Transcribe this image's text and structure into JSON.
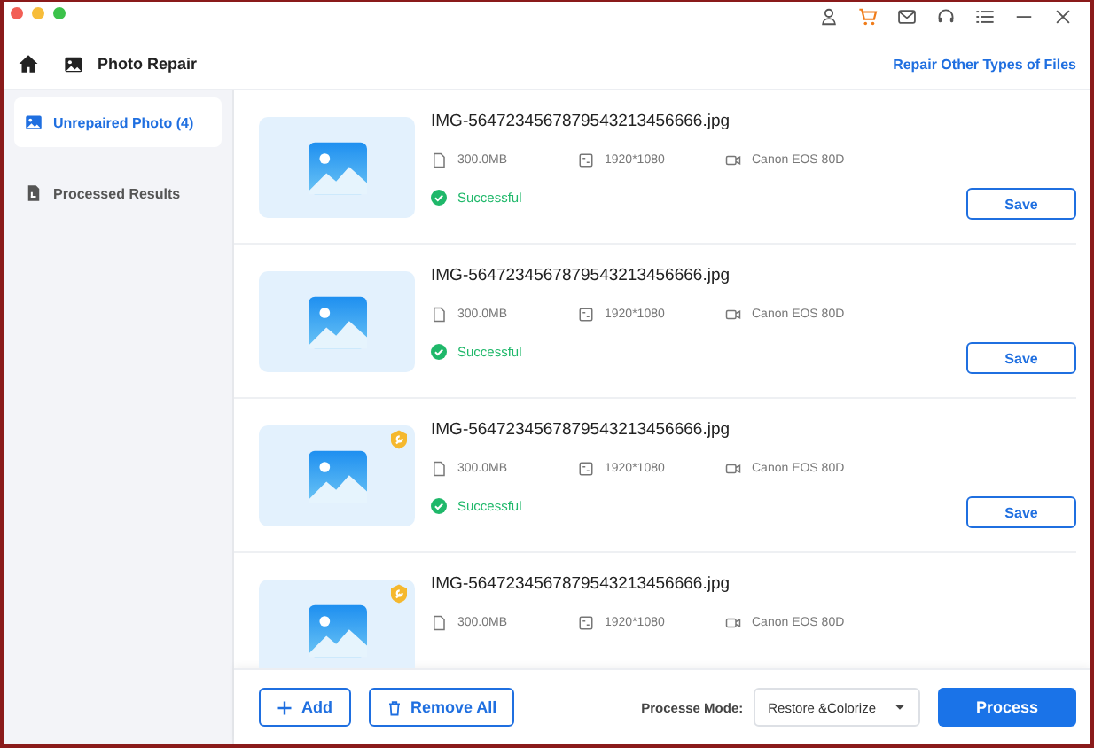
{
  "header": {
    "title": "Photo Repair",
    "link": "Repair Other Types of Files"
  },
  "sidebar": {
    "items": [
      {
        "label": "Unrepaired Photo (4)",
        "selected": true,
        "kind": "photo"
      },
      {
        "label": "Processed Results",
        "selected": false,
        "kind": "file"
      }
    ]
  },
  "files": [
    {
      "name": "IMG-5647234567879543213456666.jpg",
      "size": "300.0MB",
      "resolution": "1920*1080",
      "camera": "Canon EOS 80D",
      "badge": false,
      "status": {
        "label": "Successful",
        "kind": "success"
      },
      "save": "Save"
    },
    {
      "name": "IMG-5647234567879543213456666.jpg",
      "size": "300.0MB",
      "resolution": "1920*1080",
      "camera": "Canon EOS 80D",
      "badge": false,
      "status": {
        "label": "Successful",
        "kind": "success"
      },
      "save": "Save"
    },
    {
      "name": "IMG-5647234567879543213456666.jpg",
      "size": "300.0MB",
      "resolution": "1920*1080",
      "camera": "Canon EOS 80D",
      "badge": true,
      "status": {
        "label": "Successful",
        "kind": "success"
      },
      "save": "Save"
    },
    {
      "name": "IMG-5647234567879543213456666.jpg",
      "size": "300.0MB",
      "resolution": "1920*1080",
      "camera": "Canon EOS 80D",
      "badge": true
    }
  ],
  "footer": {
    "add": "Add",
    "remove_all": "Remove All",
    "mode_label": "Processe Mode:",
    "mode_value": "Restore &Colorize",
    "process": "Process"
  }
}
